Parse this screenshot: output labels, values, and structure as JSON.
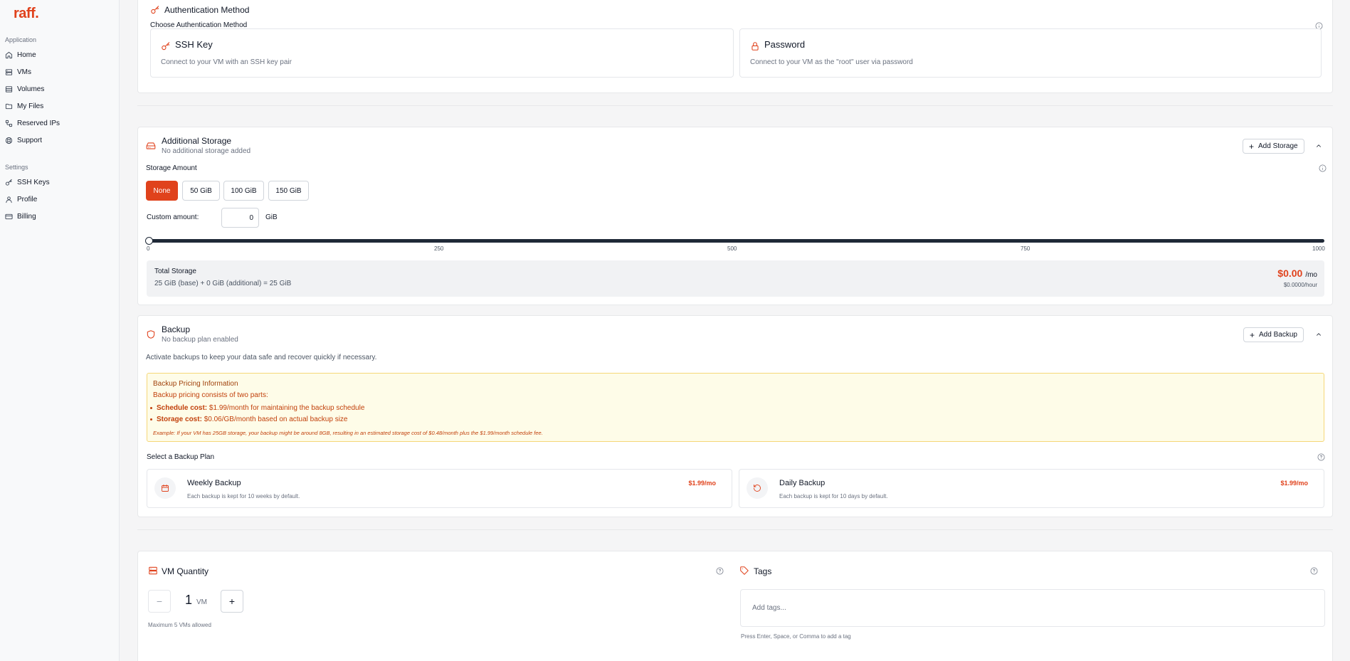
{
  "brand": {
    "logo": "raff."
  },
  "sidebar": {
    "sections": [
      {
        "label": "Application",
        "items": [
          {
            "label": "Home",
            "icon": "home-icon"
          },
          {
            "label": "VMs",
            "icon": "server-icon"
          },
          {
            "label": "Volumes",
            "icon": "database-icon"
          },
          {
            "label": "My Files",
            "icon": "folder-icon"
          },
          {
            "label": "Reserved IPs",
            "icon": "network-icon"
          },
          {
            "label": "Support",
            "icon": "lifebuoy-icon"
          }
        ]
      },
      {
        "label": "Settings",
        "items": [
          {
            "label": "SSH Keys",
            "icon": "key-icon"
          },
          {
            "label": "Profile",
            "icon": "user-icon"
          },
          {
            "label": "Billing",
            "icon": "credit-card-icon"
          }
        ]
      }
    ]
  },
  "auth": {
    "title": "Authentication Method",
    "choose_label": "Choose Authentication Method",
    "options": [
      {
        "title": "SSH Key",
        "description": "Connect to your VM with an SSH key pair",
        "icon": "key-icon"
      },
      {
        "title": "Password",
        "description": "Connect to your VM as the \"root\" user via password",
        "icon": "lock-icon"
      }
    ]
  },
  "storage": {
    "title": "Additional Storage",
    "subtitle": "No additional storage added",
    "add_button": "Add Storage",
    "amount_label": "Storage Amount",
    "amounts": [
      "None",
      "50 GiB",
      "100 GiB",
      "150 GiB"
    ],
    "selected_amount": "None",
    "custom_label": "Custom amount:",
    "custom_value": "0",
    "custom_unit": "GiB",
    "slider": {
      "min": 0,
      "max": 1000,
      "value": 0,
      "ticks": [
        "0",
        "250",
        "500",
        "750",
        "1000"
      ]
    },
    "total_title": "Total Storage",
    "total_formula": "25 GiB (base) + 0 GiB (additional) = 25 GiB",
    "price": "$0.00",
    "price_unit": "/mo",
    "hourly": "$0.0000/hour"
  },
  "backup": {
    "title": "Backup",
    "subtitle": "No backup plan enabled",
    "add_button": "Add Backup",
    "description": "Activate backups to keep your data safe and recover quickly if necessary.",
    "notice": {
      "title": "Backup Pricing Information",
      "subtitle": "Backup pricing consists of two parts:",
      "items": [
        {
          "label": "Schedule cost:",
          "text": "$1.99/month for maintaining the backup schedule"
        },
        {
          "label": "Storage cost:",
          "text": "$0.06/GB/month based on actual backup size"
        }
      ],
      "example": "Example: If your VM has 25GB storage, your backup might be around 8GB, resulting in an estimated storage cost of $0.48/month plus the $1.99/month schedule fee."
    },
    "plan_label": "Select a Backup Plan",
    "plans": [
      {
        "title": "Weekly Backup",
        "description": "Each backup is kept for 10 weeks by default.",
        "price": "$1.99/mo",
        "icon": "calendar-icon"
      },
      {
        "title": "Daily Backup",
        "description": "Each backup is kept for 10 days by default.",
        "price": "$1.99/mo",
        "icon": "rotate-icon"
      }
    ]
  },
  "quantity": {
    "title": "VM Quantity",
    "value": "1",
    "unit": "VM",
    "decrement": "−",
    "increment": "+",
    "max_note": "Maximum 5 VMs allowed"
  },
  "tags": {
    "title": "Tags",
    "placeholder": "Add tags...",
    "hint": "Press Enter, Space, or Comma to add a tag"
  },
  "colors": {
    "accent": "#e0421c",
    "notice_bg": "#fefce8",
    "notice_text": "#c2410c"
  }
}
